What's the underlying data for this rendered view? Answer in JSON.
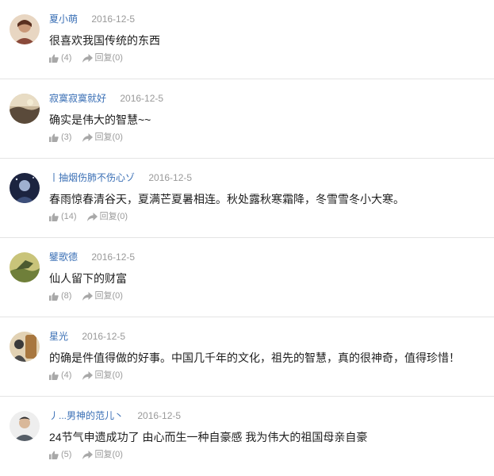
{
  "comments": [
    {
      "username": "夏小萌",
      "date": "2016-12-5",
      "text": "很喜欢我国传统的东西",
      "likes": "(4)",
      "reply_label": "回复",
      "replies": "(0)",
      "avatar_color": "#b07a5c"
    },
    {
      "username": "寂寞寂寞就好",
      "date": "2016-12-5",
      "text": "确实是伟大的智慧~~",
      "likes": "(3)",
      "reply_label": "回复",
      "replies": "(0)",
      "avatar_color": "#7a6a58"
    },
    {
      "username": "丨抽烟伤肺不伤心ゾ",
      "date": "2016-12-5",
      "text": "春雨惊春清谷天，夏满芒夏暑相连。秋处露秋寒霜降，冬雪雪冬小大寒。",
      "likes": "(14)",
      "reply_label": "回复",
      "replies": "(0)",
      "avatar_color": "#2a3654"
    },
    {
      "username": "鐾歌德",
      "date": "2016-12-5",
      "text": "仙人留下的财富",
      "likes": "(8)",
      "reply_label": "回复",
      "replies": "(0)",
      "avatar_color": "#8a9a50"
    },
    {
      "username": "星光",
      "date": "2016-12-5",
      "text": "的确是件值得做的好事。中国几千年的文化，祖先的智慧，真的很神奇，值得珍惜！",
      "likes": "(4)",
      "reply_label": "回复",
      "replies": "(0)",
      "avatar_color": "#b08a5a"
    },
    {
      "username": "丿...男神的范儿丶",
      "date": "2016-12-5",
      "text": "24节气申遗成功了 由心而生一种自豪感 我为伟大的祖国母亲自豪",
      "likes": "(5)",
      "reply_label": "回复",
      "replies": "(0)",
      "avatar_color": "#c8c8c8"
    }
  ],
  "icons": {
    "like": "thumbs-up-icon",
    "reply": "reply-arrow-icon"
  },
  "colors": {
    "username": "#3a6fb5",
    "meta": "#999999",
    "divider": "#e4e4e4"
  }
}
